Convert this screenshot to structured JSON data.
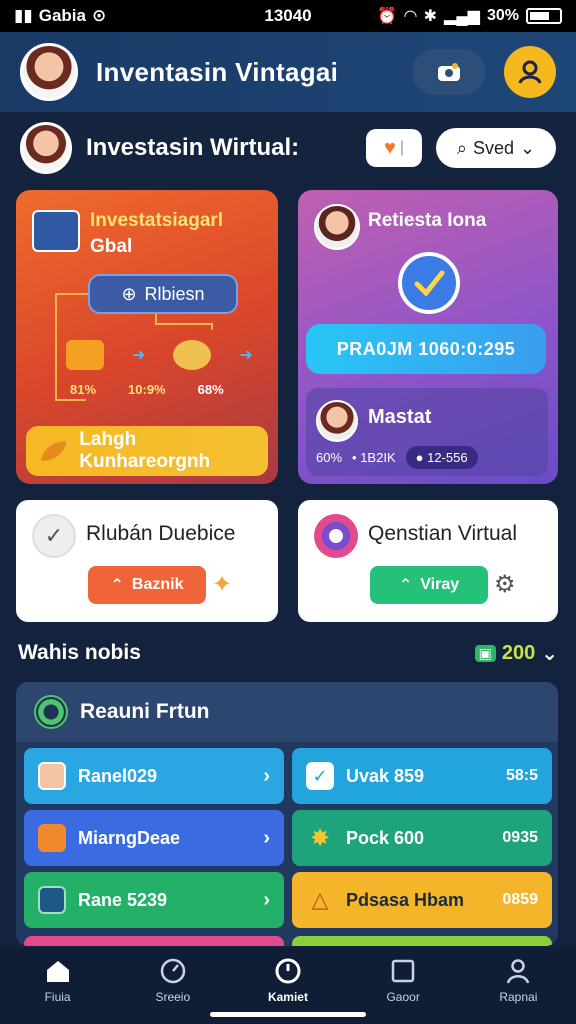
{
  "status_bar": {
    "carrier": "Gabia",
    "time": "13040",
    "battery": "30%"
  },
  "header": {
    "app_title": "Inventasin Vintagai"
  },
  "sub_header": {
    "title": "Investasin Wirtual:",
    "saved_label": "Sved"
  },
  "card_left": {
    "title_line1": "Investatsiagarl",
    "title_line2": "Gbal",
    "flow_chip_label": "Rlbiesn",
    "flow_labels": [
      "81%",
      "10:9%",
      "68%"
    ],
    "cta_label": "Lahgh Kunhareorgnh"
  },
  "card_right": {
    "title": "Retiesta Iona",
    "promo_button": "PRA0JM 1060:0:295",
    "inner_name": "Mastat",
    "inner_stat1": "60%",
    "inner_stat2": "1B2IK",
    "inner_stat3": "12-556"
  },
  "card_white_left": {
    "title": "Rlubán Duebice",
    "button": "Baznik"
  },
  "card_white_right": {
    "title": "Qenstian Virtual",
    "button": "Viray"
  },
  "section": {
    "title": "Wahis nobis",
    "count": "200"
  },
  "panel": {
    "title": "Reauni Frtun",
    "tiles_left": [
      {
        "label": "Ranel029",
        "color": "#2aa7e2"
      },
      {
        "label": "MiarngDeae",
        "color": "#3a6be0"
      },
      {
        "label": "Rane 5239",
        "color": "#25b06a"
      }
    ],
    "tiles_right": [
      {
        "label": "Uvak 859",
        "value": "58:5",
        "color": "#22a4dd"
      },
      {
        "label": "Pock 600",
        "value": "0935",
        "color": "#1fa37c"
      },
      {
        "label": "Pdsasa Hbam",
        "value": "0859",
        "color": "#f4b52a"
      }
    ]
  },
  "tabbar": {
    "tabs": [
      "Fiuia",
      "Sreeio",
      "Kamiet",
      "Gaoor",
      "Rapnai"
    ],
    "active_index": 2
  }
}
